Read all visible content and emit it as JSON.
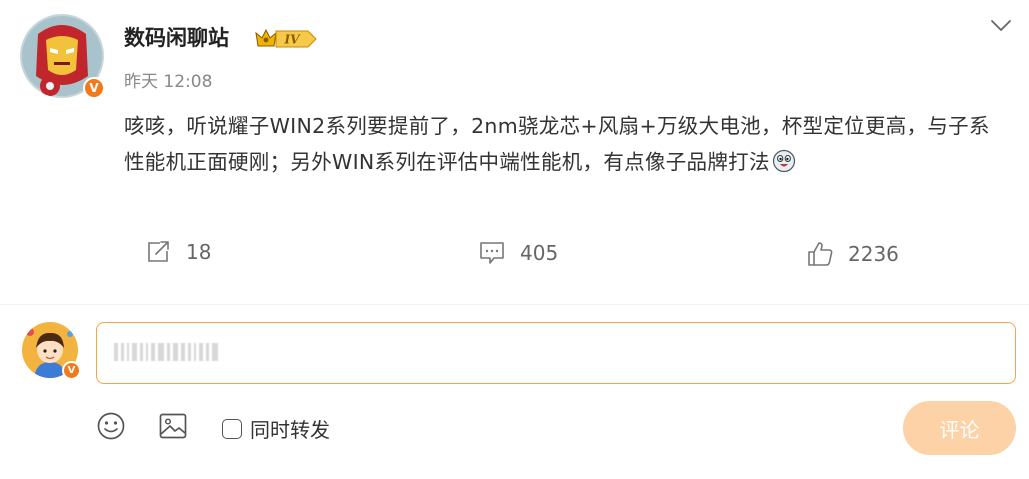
{
  "post": {
    "author": "数码闲聊站",
    "level_badge": "IV",
    "timestamp": "昨天 12:08",
    "text": "咳咳，听说耀子WIN2系列要提前了，2nm骁龙芯+风扇+万级大电池，杯型定位更高，与子系性能机正面硬刚；另外WIN系列在评估中端性能机，有点像子品牌打法",
    "avatar_badge": "V"
  },
  "actions": {
    "repost_count": "18",
    "comment_count": "405",
    "like_count": "2236"
  },
  "composer": {
    "avatar_badge": "V",
    "forward_label": "同时转发",
    "submit_label": "评论"
  },
  "colors": {
    "accent": "#f27a1a",
    "input_border": "#f7a54a",
    "submit_bg": "#fcd2a6",
    "badge_gold": "#f0b400"
  },
  "icons": [
    "vip-crown-icon",
    "chevron-down-icon",
    "repost-icon",
    "comment-icon",
    "like-icon",
    "emoji-icon",
    "image-icon",
    "laughing-emoji-icon"
  ]
}
